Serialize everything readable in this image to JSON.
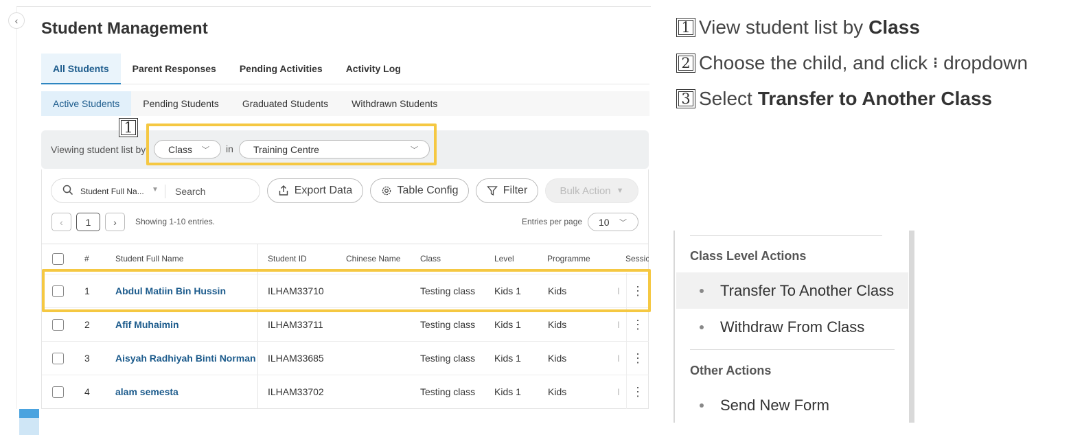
{
  "page": {
    "title": "Student Management"
  },
  "main_tabs": [
    "All Students",
    "Parent Responses",
    "Pending Activities",
    "Activity Log"
  ],
  "sub_tabs": [
    "Active Students",
    "Pending Students",
    "Graduated Students",
    "Withdrawn Students"
  ],
  "view_bar": {
    "label": "Viewing student list by",
    "by_value": "Class",
    "in_label": "in",
    "centre_value": "Training Centre"
  },
  "toolbar": {
    "search_field": "Student Full Na...",
    "search_placeholder": "Search",
    "export_label": "Export Data",
    "config_label": "Table Config",
    "filter_label": "Filter",
    "bulk_label": "Bulk Action"
  },
  "pagination": {
    "prev": "‹",
    "page": "1",
    "next": "›",
    "showing": "Showing 1-10 entries.",
    "entries_label": "Entries per page",
    "entries_value": "10"
  },
  "table": {
    "headers": [
      "#",
      "Student Full Name",
      "Student ID",
      "Chinese Name",
      "Class",
      "Level",
      "Programme",
      "Sessic"
    ],
    "rows": [
      {
        "num": "1",
        "name": "Abdul Matiin Bin Hussin",
        "id": "ILHAM33710",
        "chinese": "",
        "class": "Testing class",
        "level": "Kids 1",
        "programme": "Kids",
        "session": "I"
      },
      {
        "num": "2",
        "name": "Afif Muhaimin",
        "id": "ILHAM33711",
        "chinese": "",
        "class": "Testing class",
        "level": "Kids 1",
        "programme": "Kids",
        "session": "I"
      },
      {
        "num": "3",
        "name": "Aisyah Radhiyah Binti Norman",
        "id": "ILHAM33685",
        "chinese": "",
        "class": "Testing class",
        "level": "Kids 1",
        "programme": "Kids",
        "session": "I"
      },
      {
        "num": "4",
        "name": "alam semesta",
        "id": "ILHAM33702",
        "chinese": "",
        "class": "Testing class",
        "level": "Kids 1",
        "programme": "Kids",
        "session": "I"
      }
    ]
  },
  "instructions": {
    "step1_num": "1",
    "step1_text": "View student list by",
    "step1_bold": "Class",
    "step2_num": "2",
    "step2_text": "Choose the child, and click",
    "step2_glyph": "⁝",
    "step2_after": "dropdown",
    "step3_num": "3",
    "step3_text": "Select",
    "step3_bold": "Transfer to Another Class"
  },
  "action_menu": {
    "class_group": "Class Level Actions",
    "transfer": "Transfer To Another Class",
    "withdraw": "Withdraw From Class",
    "other_group": "Other Actions",
    "send_form": "Send New Form"
  },
  "colors": {
    "highlight": "#f5c842",
    "link": "#1c5b8c",
    "active_tab_bg": "#eaf4fb",
    "accent": "#2e86c1"
  },
  "icons": [
    "collapse-icon",
    "search-icon",
    "export-icon",
    "gear-icon",
    "filter-icon",
    "chevron-down-icon",
    "kebab-icon"
  ]
}
